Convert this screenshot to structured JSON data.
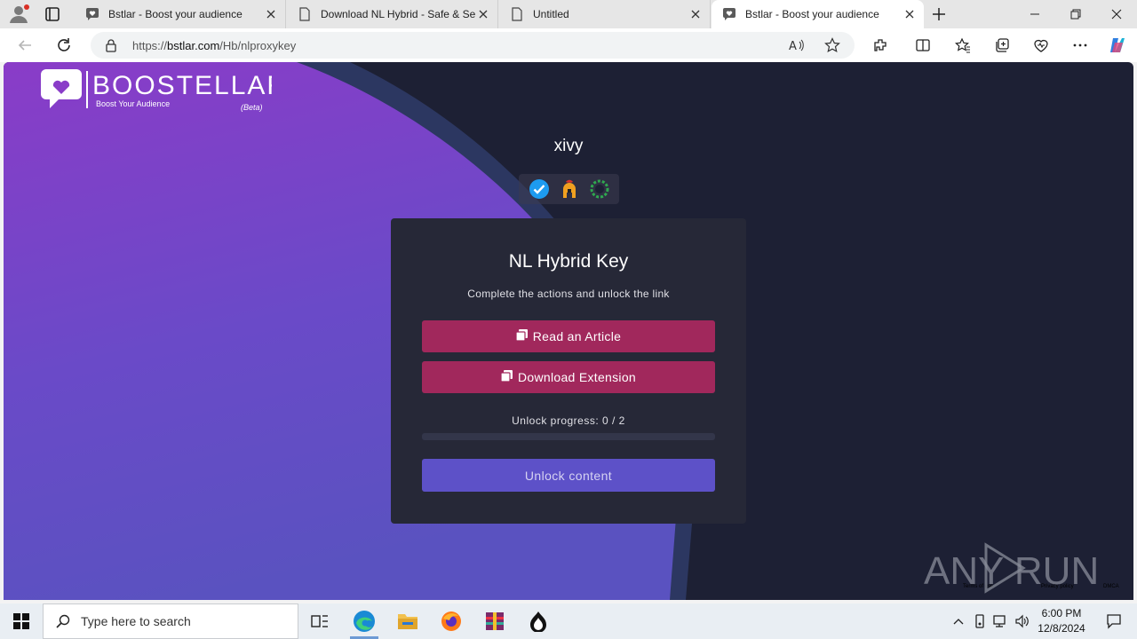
{
  "browser": {
    "tabs": [
      {
        "title": "Bstlar - Boost your audience",
        "icon": "heart-chat-icon",
        "active": false
      },
      {
        "title": "Download NL Hybrid - Safe & Se",
        "icon": "page-icon",
        "active": false
      },
      {
        "title": "Untitled",
        "icon": "page-icon",
        "active": false
      },
      {
        "title": "Bstlar - Boost your audience",
        "icon": "heart-chat-icon",
        "active": true
      }
    ],
    "url_prefix": "https://",
    "url_domain": "bstlar.com",
    "url_path": "/Hb/nlproxykey"
  },
  "page": {
    "logo_text": "BOOSTELLAR",
    "logo_tagline": "Boost Your Audience",
    "logo_beta": "(Beta)",
    "username": "xivy",
    "badges": [
      "verified-check-icon",
      "spartan-helmet-icon",
      "laurel-wreath-icon"
    ],
    "card": {
      "title": "NL Hybrid Key",
      "subtitle": "Complete the actions and unlock the link",
      "actions": [
        {
          "label": "Read an Article",
          "icon": "copy-icon"
        },
        {
          "label": "Download Extension",
          "icon": "copy-icon"
        }
      ],
      "progress_label": "Unlock progress: 0 / 2",
      "progress_fraction": 0,
      "unlock_label": "Unlock content"
    },
    "footer": [
      "Terms of use",
      "Privacy policy",
      "DMCA"
    ],
    "watermark": "ANY RUN"
  },
  "taskbar": {
    "search_placeholder": "Type here to search",
    "pinned": [
      "task-view-icon",
      "edge-icon",
      "file-explorer-icon",
      "firefox-icon",
      "winrar-icon",
      "app-icon"
    ],
    "time": "6:00 PM",
    "date": "12/8/2024"
  },
  "colors": {
    "accent_button": "#a1285c",
    "unlock_button": "#5d51c8",
    "card_bg": "#262837",
    "page_dark": "#1d2034",
    "purple_gradient": [
      "#8a3cc8",
      "#5a52c0"
    ]
  }
}
